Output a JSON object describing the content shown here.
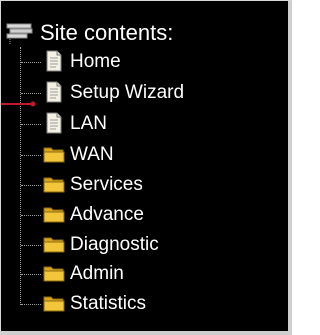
{
  "tree": {
    "root_label": "Site contents:",
    "root_icon": "tree-root-icon",
    "items": [
      {
        "label": "Home",
        "icon": "page-icon"
      },
      {
        "label": "Setup Wizard",
        "icon": "page-icon"
      },
      {
        "label": "LAN",
        "icon": "page-icon"
      },
      {
        "label": "WAN",
        "icon": "folder-icon"
      },
      {
        "label": "Services",
        "icon": "folder-icon"
      },
      {
        "label": "Advance",
        "icon": "folder-icon"
      },
      {
        "label": "Diagnostic",
        "icon": "folder-icon"
      },
      {
        "label": "Admin",
        "icon": "folder-icon"
      },
      {
        "label": "Statistics",
        "icon": "folder-icon"
      }
    ]
  },
  "colors": {
    "background": "#000000",
    "text": "#ffffff",
    "pointer": "#c0192a",
    "folder": "#f2c53a"
  }
}
